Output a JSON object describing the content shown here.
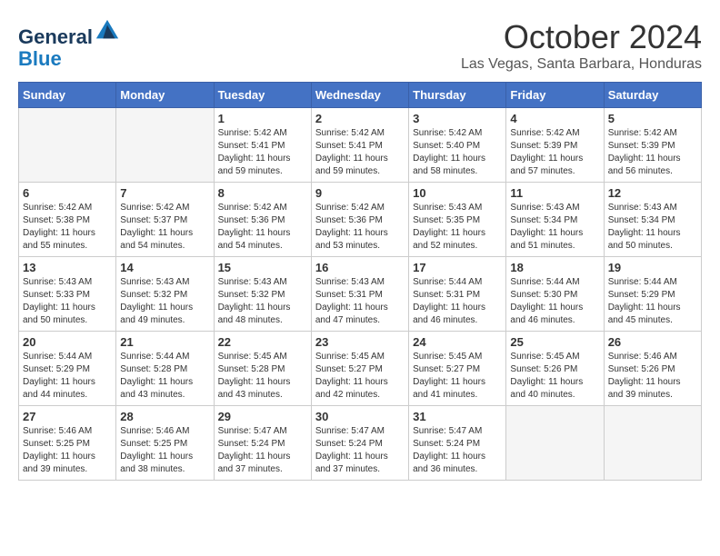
{
  "header": {
    "logo_line1": "General",
    "logo_line2": "Blue",
    "month": "October 2024",
    "location": "Las Vegas, Santa Barbara, Honduras"
  },
  "weekdays": [
    "Sunday",
    "Monday",
    "Tuesday",
    "Wednesday",
    "Thursday",
    "Friday",
    "Saturday"
  ],
  "weeks": [
    [
      {
        "day": "",
        "empty": true
      },
      {
        "day": "",
        "empty": true
      },
      {
        "day": "1",
        "sunrise": "Sunrise: 5:42 AM",
        "sunset": "Sunset: 5:41 PM",
        "daylight": "Daylight: 11 hours and 59 minutes."
      },
      {
        "day": "2",
        "sunrise": "Sunrise: 5:42 AM",
        "sunset": "Sunset: 5:41 PM",
        "daylight": "Daylight: 11 hours and 59 minutes."
      },
      {
        "day": "3",
        "sunrise": "Sunrise: 5:42 AM",
        "sunset": "Sunset: 5:40 PM",
        "daylight": "Daylight: 11 hours and 58 minutes."
      },
      {
        "day": "4",
        "sunrise": "Sunrise: 5:42 AM",
        "sunset": "Sunset: 5:39 PM",
        "daylight": "Daylight: 11 hours and 57 minutes."
      },
      {
        "day": "5",
        "sunrise": "Sunrise: 5:42 AM",
        "sunset": "Sunset: 5:39 PM",
        "daylight": "Daylight: 11 hours and 56 minutes."
      }
    ],
    [
      {
        "day": "6",
        "sunrise": "Sunrise: 5:42 AM",
        "sunset": "Sunset: 5:38 PM",
        "daylight": "Daylight: 11 hours and 55 minutes."
      },
      {
        "day": "7",
        "sunrise": "Sunrise: 5:42 AM",
        "sunset": "Sunset: 5:37 PM",
        "daylight": "Daylight: 11 hours and 54 minutes."
      },
      {
        "day": "8",
        "sunrise": "Sunrise: 5:42 AM",
        "sunset": "Sunset: 5:36 PM",
        "daylight": "Daylight: 11 hours and 54 minutes."
      },
      {
        "day": "9",
        "sunrise": "Sunrise: 5:42 AM",
        "sunset": "Sunset: 5:36 PM",
        "daylight": "Daylight: 11 hours and 53 minutes."
      },
      {
        "day": "10",
        "sunrise": "Sunrise: 5:43 AM",
        "sunset": "Sunset: 5:35 PM",
        "daylight": "Daylight: 11 hours and 52 minutes."
      },
      {
        "day": "11",
        "sunrise": "Sunrise: 5:43 AM",
        "sunset": "Sunset: 5:34 PM",
        "daylight": "Daylight: 11 hours and 51 minutes."
      },
      {
        "day": "12",
        "sunrise": "Sunrise: 5:43 AM",
        "sunset": "Sunset: 5:34 PM",
        "daylight": "Daylight: 11 hours and 50 minutes."
      }
    ],
    [
      {
        "day": "13",
        "sunrise": "Sunrise: 5:43 AM",
        "sunset": "Sunset: 5:33 PM",
        "daylight": "Daylight: 11 hours and 50 minutes."
      },
      {
        "day": "14",
        "sunrise": "Sunrise: 5:43 AM",
        "sunset": "Sunset: 5:32 PM",
        "daylight": "Daylight: 11 hours and 49 minutes."
      },
      {
        "day": "15",
        "sunrise": "Sunrise: 5:43 AM",
        "sunset": "Sunset: 5:32 PM",
        "daylight": "Daylight: 11 hours and 48 minutes."
      },
      {
        "day": "16",
        "sunrise": "Sunrise: 5:43 AM",
        "sunset": "Sunset: 5:31 PM",
        "daylight": "Daylight: 11 hours and 47 minutes."
      },
      {
        "day": "17",
        "sunrise": "Sunrise: 5:44 AM",
        "sunset": "Sunset: 5:31 PM",
        "daylight": "Daylight: 11 hours and 46 minutes."
      },
      {
        "day": "18",
        "sunrise": "Sunrise: 5:44 AM",
        "sunset": "Sunset: 5:30 PM",
        "daylight": "Daylight: 11 hours and 46 minutes."
      },
      {
        "day": "19",
        "sunrise": "Sunrise: 5:44 AM",
        "sunset": "Sunset: 5:29 PM",
        "daylight": "Daylight: 11 hours and 45 minutes."
      }
    ],
    [
      {
        "day": "20",
        "sunrise": "Sunrise: 5:44 AM",
        "sunset": "Sunset: 5:29 PM",
        "daylight": "Daylight: 11 hours and 44 minutes."
      },
      {
        "day": "21",
        "sunrise": "Sunrise: 5:44 AM",
        "sunset": "Sunset: 5:28 PM",
        "daylight": "Daylight: 11 hours and 43 minutes."
      },
      {
        "day": "22",
        "sunrise": "Sunrise: 5:45 AM",
        "sunset": "Sunset: 5:28 PM",
        "daylight": "Daylight: 11 hours and 43 minutes."
      },
      {
        "day": "23",
        "sunrise": "Sunrise: 5:45 AM",
        "sunset": "Sunset: 5:27 PM",
        "daylight": "Daylight: 11 hours and 42 minutes."
      },
      {
        "day": "24",
        "sunrise": "Sunrise: 5:45 AM",
        "sunset": "Sunset: 5:27 PM",
        "daylight": "Daylight: 11 hours and 41 minutes."
      },
      {
        "day": "25",
        "sunrise": "Sunrise: 5:45 AM",
        "sunset": "Sunset: 5:26 PM",
        "daylight": "Daylight: 11 hours and 40 minutes."
      },
      {
        "day": "26",
        "sunrise": "Sunrise: 5:46 AM",
        "sunset": "Sunset: 5:26 PM",
        "daylight": "Daylight: 11 hours and 39 minutes."
      }
    ],
    [
      {
        "day": "27",
        "sunrise": "Sunrise: 5:46 AM",
        "sunset": "Sunset: 5:25 PM",
        "daylight": "Daylight: 11 hours and 39 minutes."
      },
      {
        "day": "28",
        "sunrise": "Sunrise: 5:46 AM",
        "sunset": "Sunset: 5:25 PM",
        "daylight": "Daylight: 11 hours and 38 minutes."
      },
      {
        "day": "29",
        "sunrise": "Sunrise: 5:47 AM",
        "sunset": "Sunset: 5:24 PM",
        "daylight": "Daylight: 11 hours and 37 minutes."
      },
      {
        "day": "30",
        "sunrise": "Sunrise: 5:47 AM",
        "sunset": "Sunset: 5:24 PM",
        "daylight": "Daylight: 11 hours and 37 minutes."
      },
      {
        "day": "31",
        "sunrise": "Sunrise: 5:47 AM",
        "sunset": "Sunset: 5:24 PM",
        "daylight": "Daylight: 11 hours and 36 minutes."
      },
      {
        "day": "",
        "empty": true
      },
      {
        "day": "",
        "empty": true
      }
    ]
  ]
}
